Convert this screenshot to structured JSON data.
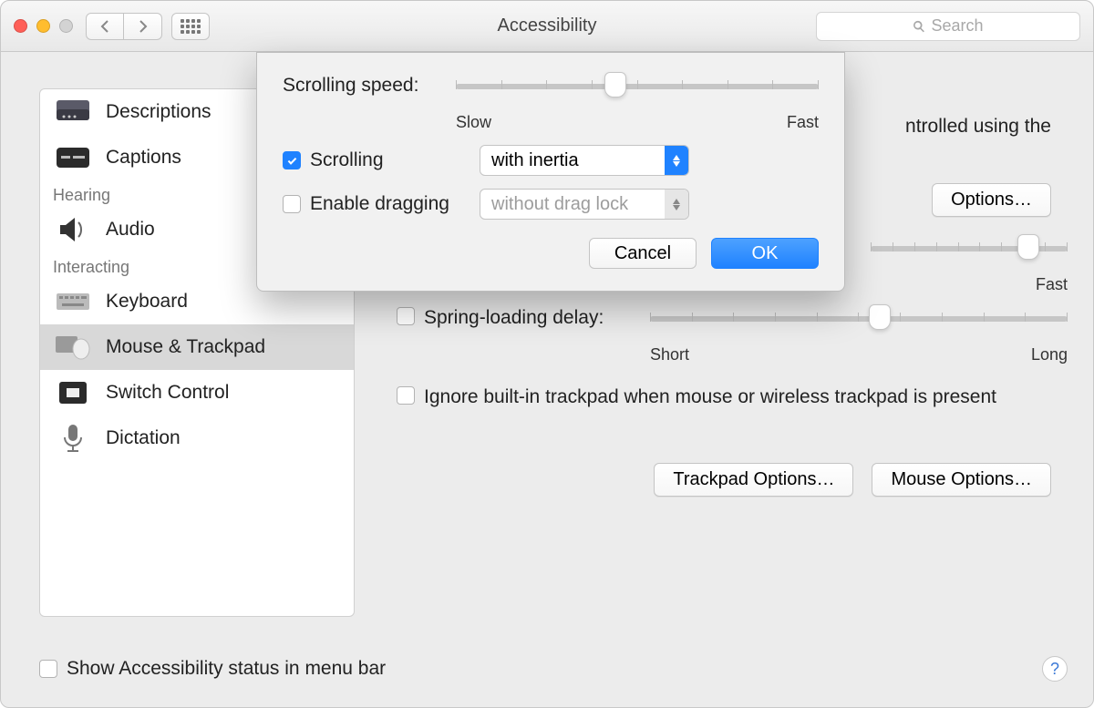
{
  "window": {
    "title": "Accessibility",
    "search_placeholder": "Search"
  },
  "sidebar": {
    "items": [
      {
        "label": "Descriptions",
        "icon": "descriptions"
      },
      {
        "label": "Captions",
        "icon": "captions"
      }
    ],
    "group1_label": "Hearing",
    "group1_items": [
      {
        "label": "Audio",
        "icon": "audio"
      }
    ],
    "group2_label": "Interacting",
    "group2_items": [
      {
        "label": "Keyboard",
        "icon": "keyboard"
      },
      {
        "label": "Mouse & Trackpad",
        "icon": "mouse-trackpad",
        "selected": true
      },
      {
        "label": "Switch Control",
        "icon": "switch-control"
      },
      {
        "label": "Dictation",
        "icon": "dictation"
      }
    ]
  },
  "main": {
    "intro_fragment": "ntrolled using the",
    "options_label": "Options…",
    "double_click_fast": "Fast",
    "spring_label": "Spring-loading delay:",
    "spring_short": "Short",
    "spring_long": "Long",
    "ignore_trackpad": "Ignore built-in trackpad when mouse or wireless trackpad is present",
    "trackpad_options": "Trackpad Options…",
    "mouse_options": "Mouse Options…"
  },
  "footer": {
    "show_status": "Show Accessibility status in menu bar",
    "help_label": "?"
  },
  "sheet": {
    "scrolling_speed_label": "Scrolling speed:",
    "slow_label": "Slow",
    "fast_label": "Fast",
    "scrolling_checkbox": "Scrolling",
    "scrolling_checked": true,
    "scrolling_select": "with inertia",
    "dragging_checkbox": "Enable dragging",
    "dragging_checked": false,
    "dragging_select": "without drag lock",
    "cancel": "Cancel",
    "ok": "OK",
    "slider_pos_pct": 44
  }
}
